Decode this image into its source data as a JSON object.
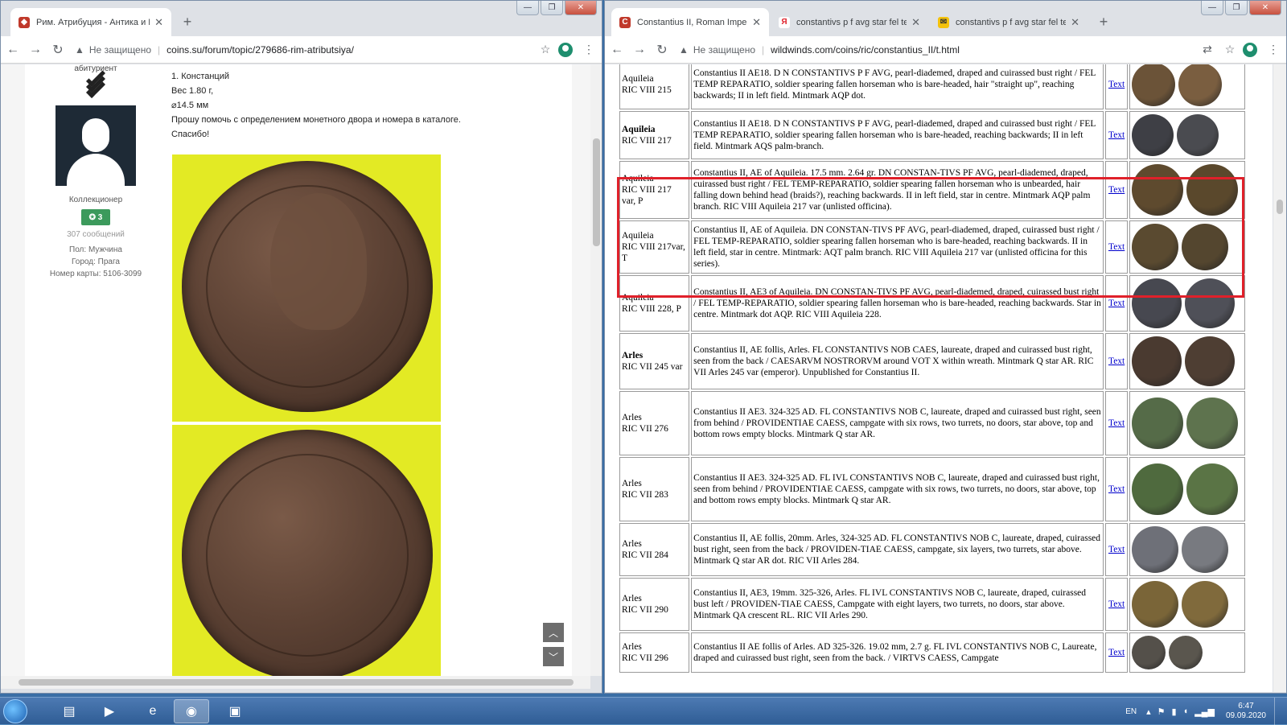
{
  "left_window": {
    "tab": {
      "title": "Рим. Атрибуция - Антика и Виз",
      "close": "✕"
    },
    "new_tab": "+",
    "address": {
      "insecure_label": "Не защищено",
      "url": "coins.su/forum/topic/279686-rim-atributsiya/"
    },
    "controls": {
      "minimize": "—",
      "maximize": "❐",
      "close": "✕"
    },
    "user": {
      "rank": "абитуриент",
      "title": "Коллекционер",
      "reputation": "✪ 3",
      "messages": "307 сообщений",
      "gender": "Пол: Мужчина",
      "city": "Город: Прага",
      "card": "Номер карты: 5106-3099"
    },
    "post": {
      "line1": "1. Констанций",
      "line2": "Вес 1.80 г,",
      "line3": "⌀14.5 мм",
      "line4": "Прошу помочь с определением монетного двора и номера в каталоге.",
      "line5": "Спасибо!"
    },
    "scroll": {
      "up": "︿",
      "down": "﹀"
    }
  },
  "right_window": {
    "tabs": [
      {
        "title": "Constantius II, Roman Imperial C",
        "color": "#c0392b",
        "glyph": "C"
      },
      {
        "title": "constantivs p f avg star fel temp",
        "color": "#ffffff",
        "glyph": "Я"
      },
      {
        "title": "constantivs p f avg star fel temp",
        "color": "#f4c20d",
        "glyph": "✉"
      }
    ],
    "tab_close": "✕",
    "new_tab": "+",
    "address": {
      "insecure_label": "Не защищено",
      "url": "wildwinds.com/coins/ric/constantius_II/t.html"
    },
    "controls": {
      "minimize": "—",
      "maximize": "❐",
      "close": "✕"
    },
    "link_text": "Text",
    "rows": [
      {
        "mint": "Aquileia",
        "ric": "RIC VIII 215",
        "bold": false,
        "desc": "Constantius II AE18. D N CONSTANTIVS P F AVG, pearl-diademed, draped and cuirassed bust right / FEL TEMP REPARATIO, soldier spearing fallen horseman who is bare-headed, hair \"straight up\", reaching backwards; II in left field. Mintmark AQP dot.",
        "coin1": "#6b5338",
        "coin2": "#7a5e40",
        "h": 62
      },
      {
        "mint": "Aquileia",
        "ric": "RIC VIII 217",
        "bold": true,
        "desc": "Constantius II AE18. D N CONSTANTIVS P F AVG, pearl-diademed, draped and cuirassed bust right / FEL TEMP REPARATIO, soldier spearing fallen horseman who is bare-headed, reaching backwards; II in left field. Mintmark AQS palm-branch.",
        "coin1": "#3e3f45",
        "coin2": "#4a4b50",
        "h": 60
      },
      {
        "mint": "Aquileia",
        "ric": "RIC VIII 217 var, P",
        "bold": false,
        "desc": "Constantius II, AE of Aquileia. 17.5 mm. 2.64 gr. DN CONSTAN-TIVS PF AVG, pearl-diademed, draped, cuirassed bust right / FEL TEMP-REPARATIO, soldier spearing fallen horseman who is unbearded, hair falling down behind head (braids?), reaching backwards. II in left field, star in centre. Mintmark AQP palm branch. RIC VIII Aquileia 217 var (unlisted officina).",
        "coin1": "#5e4a2e",
        "coin2": "#5a482c",
        "h": 72
      },
      {
        "mint": "Aquileia",
        "ric": "RIC VIII 217var, T",
        "bold": false,
        "desc": "Constantius II, AE of Aquileia. DN CONSTAN-TIVS PF AVG, pearl-diademed, draped, cuirassed bust right / FEL TEMP-REPARATIO, soldier spearing fallen horseman who is bare-headed, reaching backwards. II in left field, star in centre. Mintmark: AQT palm branch. RIC VIII Aquileia 217 var (unlisted officina for this series).",
        "coin1": "#5a4a30",
        "coin2": "#54462f",
        "h": 66
      },
      {
        "mint": "Aquileia",
        "ric": "RIC VIII 228, P",
        "bold": false,
        "desc": "Constantius II, AE3 of Aquileia. DN CONSTAN-TIVS PF AVG, pearl-diademed, draped, cuirassed bust right / FEL TEMP-REPARATIO, soldier spearing fallen horseman who is bare-headed, reaching backwards. Star in centre. Mintmark dot AQP. RIC VIII Aquileia 228.",
        "coin1": "#474850",
        "coin2": "#4f5058",
        "h": 70
      },
      {
        "mint": "Arles",
        "ric": "RIC VII 245 var",
        "bold": true,
        "desc": "Constantius II, AE follis, Arles. FL CONSTANTIVS NOB CAES, laureate, draped and cuirassed bust right, seen from the back / CAESARVM NOSTRORVM around VOT X within wreath. Mintmark Q star AR. RIC VII Arles 245 var (emperor). Unpublished for Constantius II.",
        "coin1": "#4a3a30",
        "coin2": "#4e3e33",
        "h": 70
      },
      {
        "mint": "Arles",
        "ric": "RIC VII 276",
        "bold": false,
        "desc": "Constantius II AE3. 324-325 AD. FL CONSTANTIVS NOB C, laureate, draped and cuirassed bust right, seen from behind / PROVIDENTIAE CAESS, campgate with six rows, two turrets, no doors, star above, top and bottom rows empty blocks. Mintmark Q star AR.",
        "coin1": "#556b48",
        "coin2": "#5e734e",
        "h": 80
      },
      {
        "mint": "Arles",
        "ric": "RIC VII 283",
        "bold": false,
        "desc": "Constantius II AE3. 324-325 AD. FL IVL CONSTANTIVS NOB C, laureate, draped and cuirassed bust right, seen from behind / PROVIDENTIAE CAESS, campgate with six rows, two turrets, no doors, star above, top and bottom rows empty blocks. Mintmark Q star AR.",
        "coin1": "#4f6a3e",
        "coin2": "#5a7445",
        "h": 80
      },
      {
        "mint": "Arles",
        "ric": "RIC VII 284",
        "bold": false,
        "desc": "Constantius II, AE follis, 20mm. Arles, 324-325 AD. FL CONSTANTIVS NOB C, laureate, draped, cuirassed bust right, seen from the back / PROVIDEN-TIAE CAESS, campgate, six layers, two turrets, star above. Mintmark Q star AR dot. RIC VII Arles 284.",
        "coin1": "#6e7078",
        "coin2": "#787a80",
        "h": 66
      },
      {
        "mint": "Arles",
        "ric": "RIC VII 290",
        "bold": false,
        "desc": "Constantius II, AE3, 19mm. 325-326, Arles. FL IVL CONSTANTIVS NOB C, laureate, draped, cuirassed bust left / PROVIDEN-TIAE CAESS, Campgate with eight layers, two turrets, no doors, star above. Mintmark QA crescent RL. RIC VII Arles 290.",
        "coin1": "#7a6538",
        "coin2": "#806a3c",
        "h": 66
      },
      {
        "mint": "Arles",
        "ric": "RIC VII 296",
        "bold": false,
        "desc": "Constantius II AE follis of Arles. AD 325-326. 19.02 mm, 2.7 g. FL IVL CONSTANTIVS NOB C, Laureate, draped and cuirassed bust right, seen from the back. / VIRTVS CAESS, Campgate",
        "coin1": "#54504a",
        "coin2": "#5a564e",
        "h": 50
      }
    ]
  },
  "taskbar": {
    "lang": "EN",
    "time": "6:47",
    "date": "09.09.2020"
  }
}
